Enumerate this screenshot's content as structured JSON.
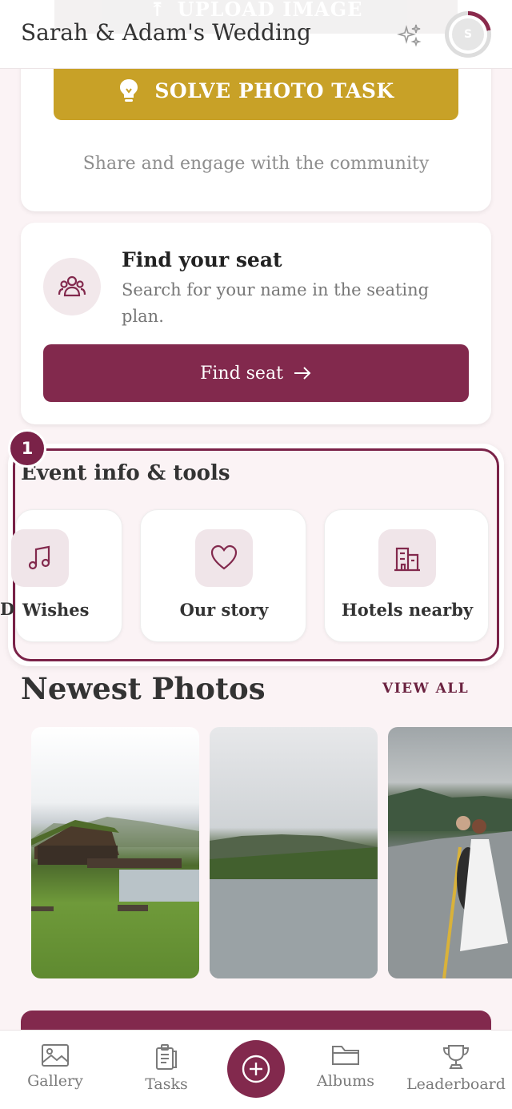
{
  "header": {
    "upload_label": "UPLOAD IMAGE",
    "title": "Sarah & Adam's Wedding",
    "avatar_initial": "S"
  },
  "task_card": {
    "solve_label": "SOLVE PHOTO TASK",
    "subtitle": "Share and engage with the community"
  },
  "seat_card": {
    "title": "Find your seat",
    "description": "Search for your name in the seating plan.",
    "button_label": "Find seat"
  },
  "event_tools": {
    "badge": "1",
    "title": "Event info & tools",
    "clipped_label": "D",
    "items": [
      {
        "label": "Wishes",
        "icon": "music-note-icon"
      },
      {
        "label": "Our story",
        "icon": "heart-icon"
      },
      {
        "label": "Hotels nearby",
        "icon": "hotel-icon"
      }
    ]
  },
  "newest_photos": {
    "title": "Newest Photos",
    "view_all": "VIEW ALL"
  },
  "nav": {
    "items": [
      {
        "label": "Gallery",
        "icon": "image-icon"
      },
      {
        "label": "Tasks",
        "icon": "clipboard-icon"
      },
      {
        "label": "Albums",
        "icon": "folder-icon"
      },
      {
        "label": "Leaderboard",
        "icon": "trophy-icon"
      }
    ]
  },
  "colors": {
    "primary": "#82294d",
    "accent_gold": "#c8a127",
    "background": "#fbf3f5"
  }
}
